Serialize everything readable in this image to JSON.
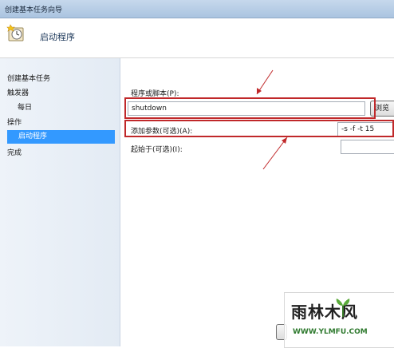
{
  "window": {
    "title": "创建基本任务向导"
  },
  "header": {
    "title": "启动程序",
    "icon": "clock-task-icon"
  },
  "sidebar": {
    "items": [
      {
        "label": "创建基本任务"
      },
      {
        "label": "触发器"
      },
      {
        "label": "每日"
      },
      {
        "label": "操作"
      },
      {
        "label": "启动程序",
        "selected": true
      },
      {
        "label": "完成"
      }
    ]
  },
  "form": {
    "program_label": "程序或脚本(P):",
    "program_value": "shutdown",
    "browse_label": "浏览",
    "args_label": "添加参数(可选)(A):",
    "args_value": "-s -f -t 15",
    "start_in_label": "起始于(可选)(I):",
    "start_in_value": ""
  },
  "watermark": {
    "brand": "雨林木风",
    "url": "WWW.YLMFU.COM"
  },
  "colors": {
    "highlight": "#c0282a",
    "selection": "#3399ff",
    "title_bar": "#b9cfe7"
  }
}
